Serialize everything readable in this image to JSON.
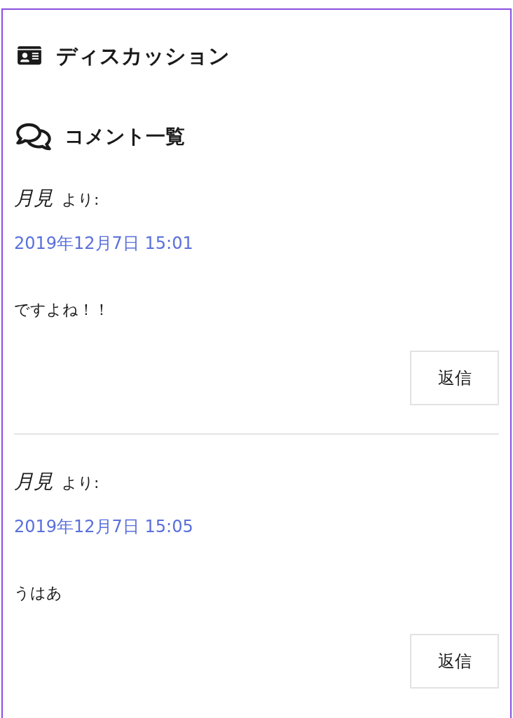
{
  "section": {
    "title": "ディスカッション"
  },
  "comments_heading": "コメント一覧",
  "comments": [
    {
      "author": "月見",
      "suffix": "より:",
      "date": "2019年12月7日 15:01",
      "body": "ですよね！！",
      "reply": "返信"
    },
    {
      "author": "月見",
      "suffix": "より:",
      "date": "2019年12月7日 15:05",
      "body": "うはあ",
      "reply": "返信"
    }
  ]
}
